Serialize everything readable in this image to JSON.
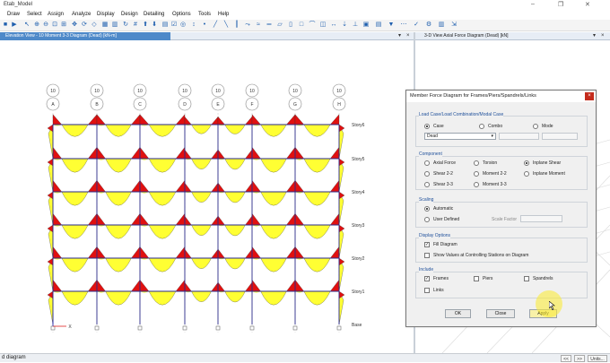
{
  "window": {
    "title": "Etab_Model"
  },
  "menu": [
    "Draw",
    "Select",
    "Assign",
    "Analyze",
    "Display",
    "Design",
    "Detailing",
    "Options",
    "Tools",
    "Help"
  ],
  "left_tab": {
    "title": "Elevation View - 10   Moment 3-3 Diagram   (Dead)  [kN-m]"
  },
  "right_tab": {
    "title": "3-D View   Axial Force Diagram   (Dead)  [kN]"
  },
  "grid": {
    "top_labels": [
      "10",
      "10",
      "10",
      "10",
      "10",
      "10",
      "10",
      "10"
    ],
    "letters": [
      "A",
      "B",
      "C",
      "D",
      "E",
      "F",
      "G",
      "H"
    ],
    "stories": [
      "Story6",
      "Story5",
      "Story4",
      "Story3",
      "Story2",
      "Story1",
      "Base"
    ]
  },
  "dialog": {
    "title": "Member Force Diagram for Frames/Piers/Spandrels/Links",
    "close": "×",
    "load_group": "Load Case/Load Combination/Modal Case",
    "load_options": [
      {
        "label": "Case",
        "selected": true
      },
      {
        "label": "Combo",
        "selected": false
      },
      {
        "label": "Mode",
        "selected": false
      }
    ],
    "load_case_value": "Dead",
    "component_group": "Component",
    "components": [
      {
        "label": "Axial Force",
        "selected": false
      },
      {
        "label": "Torsion",
        "selected": false
      },
      {
        "label": "Inplane Shear",
        "selected": true
      },
      {
        "label": "Shear 2-2",
        "selected": false
      },
      {
        "label": "Moment 2-2",
        "selected": false
      },
      {
        "label": "Inplane Moment",
        "selected": false
      },
      {
        "label": "Shear 3-3",
        "selected": false
      },
      {
        "label": "Moment 3-3",
        "selected": false
      }
    ],
    "scaling_group": "Scaling",
    "scaling_options": [
      {
        "label": "Automatic",
        "selected": true
      },
      {
        "label": "User Defined",
        "selected": false
      }
    ],
    "scale_factor_label": "Scale Factor",
    "display_group": "Display Options",
    "fill_diagram": {
      "label": "Fill Diagram",
      "checked": true
    },
    "show_values": {
      "label": "Show Values at Controlling Stations on Diagram",
      "checked": false
    },
    "include_group": "Include",
    "include": [
      {
        "label": "Frames",
        "checked": true
      },
      {
        "label": "Piers",
        "checked": false
      },
      {
        "label": "Spandrels",
        "checked": false
      },
      {
        "label": "Links",
        "checked": false
      }
    ],
    "buttons": {
      "ok": "OK",
      "close": "Close",
      "apply": "Apply"
    }
  },
  "status": {
    "text": "d diagram",
    "units": "Units..."
  },
  "colors": {
    "fill": "#ffff33",
    "negative": "#e01010",
    "frame": "#2a2a8a",
    "accent": "#4e89c9"
  }
}
